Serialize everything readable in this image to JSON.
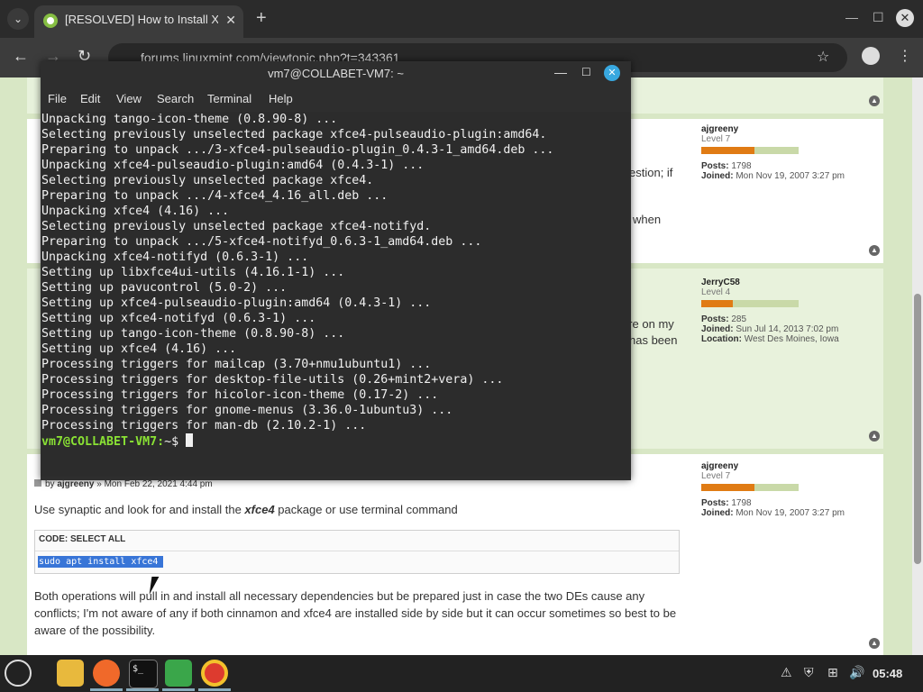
{
  "browser": {
    "tab_title": "[RESOLVED] How to Install X",
    "tab_close": "✕",
    "new_tab": "+",
    "url": "forums.linuxmint.com/viewtopic.php?t=343361",
    "minimize": "—",
    "maximize": "☐",
    "close": "✕"
  },
  "page": {
    "posts": [
      {
        "author": "ajgreeny",
        "rank": "Level 7",
        "rank_fraction": 0.55,
        "posts": "1798",
        "joined": "Mon Nov 19, 2007 3:27 pm",
        "body_fragments": [
          "estion; if",
          "when"
        ]
      },
      {
        "author": "JerryC58",
        "rank": "Level 4",
        "rank_fraction": 0.32,
        "posts": "285",
        "joined": "Sun Jul 14, 2013 7:02 pm",
        "location": "West Des Moines, Iowa",
        "body_fragments": [
          "ere on my",
          "has been"
        ]
      },
      {
        "author": "ajgreeny",
        "rank": "Level 7",
        "rank_fraction": 0.55,
        "posts": "1798",
        "joined": "Mon Nov 19, 2007 3:27 pm",
        "byline_by": "by",
        "byline_author": "ajgreeny",
        "byline_date": "» Mon Feb 22, 2021 4:44 pm",
        "intro_before": "Use synaptic and look for and install the ",
        "intro_em": "xfce4",
        "intro_after": " package or use terminal command",
        "code_header": "CODE: SELECT ALL",
        "code": "sudo apt install xfce4",
        "para1": "Both operations will pull in and install all necessary dependencies but be prepared just in case the two DEs cause any",
        "para2": "conflicts; I'm not aware of any if both cinnamon and xfce4 are installed side by side but it can occur sometimes so best to be",
        "para3": "aware of the possibility."
      }
    ],
    "labels": {
      "posts": "Posts:",
      "joined": "Joined:",
      "location": "Location:"
    }
  },
  "terminal": {
    "title": "vm7@COLLABET-VM7: ~",
    "menu": [
      "File",
      "Edit",
      "View",
      "Search",
      "Terminal",
      "Help"
    ],
    "lines": [
      "Unpacking tango-icon-theme (0.8.90-8) ...",
      "Selecting previously unselected package xfce4-pulseaudio-plugin:amd64.",
      "Preparing to unpack .../3-xfce4-pulseaudio-plugin_0.4.3-1_amd64.deb ...",
      "Unpacking xfce4-pulseaudio-plugin:amd64 (0.4.3-1) ...",
      "Selecting previously unselected package xfce4.",
      "Preparing to unpack .../4-xfce4_4.16_all.deb ...",
      "Unpacking xfce4 (4.16) ...",
      "Selecting previously unselected package xfce4-notifyd.",
      "Preparing to unpack .../5-xfce4-notifyd_0.6.3-1_amd64.deb ...",
      "Unpacking xfce4-notifyd (0.6.3-1) ...",
      "Setting up libxfce4ui-utils (4.16.1-1) ...",
      "Setting up pavucontrol (5.0-2) ...",
      "Setting up xfce4-pulseaudio-plugin:amd64 (0.4.3-1) ...",
      "Setting up xfce4-notifyd (0.6.3-1) ...",
      "Setting up tango-icon-theme (0.8.90-8) ...",
      "Setting up xfce4 (4.16) ...",
      "Processing triggers for mailcap (3.70+nmu1ubuntu1) ...",
      "Processing triggers for desktop-file-utils (0.26+mint2+vera) ...",
      "Processing triggers for hicolor-icon-theme (0.17-2) ...",
      "Processing triggers for gnome-menus (3.36.0-1ubuntu3) ...",
      "Processing triggers for man-db (2.10.2-1) ..."
    ],
    "prompt": "vm7@COLLABET-VM7:",
    "prompt_suffix": "~$ "
  },
  "taskbar": {
    "apps": [
      "menu-icon",
      "files-icon",
      "firefox-icon",
      "terminal-icon",
      "security-icon",
      "chrome-icon"
    ],
    "terminal_glyph": "$_",
    "clock": "05:48"
  }
}
